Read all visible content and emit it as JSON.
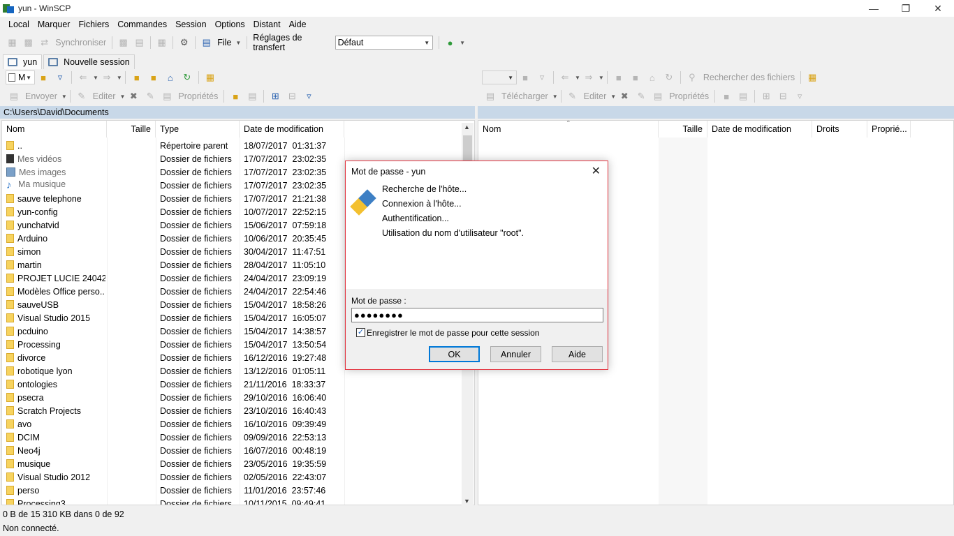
{
  "window": {
    "title": "yun - WinSCP"
  },
  "menu": [
    "Local",
    "Marquer",
    "Fichiers",
    "Commandes",
    "Session",
    "Options",
    "Distant",
    "Aide"
  ],
  "toolbar": {
    "sync_label": "Synchroniser",
    "file_label": "File",
    "transfer_settings_label": "Réglages de transfert",
    "transfer_preset": "Défaut"
  },
  "tabs": [
    {
      "label": "yun"
    },
    {
      "label": "Nouvelle session"
    }
  ],
  "local": {
    "drive_label": "M",
    "upload_label": "Envoyer",
    "edit_label": "Editer",
    "properties_label": "Propriétés",
    "path": "C:\\Users\\David\\Documents",
    "columns": [
      "Nom",
      "Taille",
      "Type",
      "Date de modification"
    ],
    "rows": [
      {
        "name": "..",
        "type": "Répertoire parent",
        "date": "18/07/2017  01:31:37",
        "icon": "up"
      },
      {
        "name": "Mes vidéos",
        "type": "Dossier de fichiers",
        "date": "17/07/2017  23:02:35",
        "icon": "video",
        "dim": true
      },
      {
        "name": "Mes images",
        "type": "Dossier de fichiers",
        "date": "17/07/2017  23:02:35",
        "icon": "image",
        "dim": true
      },
      {
        "name": "Ma musique",
        "type": "Dossier de fichiers",
        "date": "17/07/2017  23:02:35",
        "icon": "music",
        "dim": true
      },
      {
        "name": "sauve telephone",
        "type": "Dossier de fichiers",
        "date": "17/07/2017  21:21:38",
        "icon": "folder"
      },
      {
        "name": "yun-config",
        "type": "Dossier de fichiers",
        "date": "10/07/2017  22:52:15",
        "icon": "folder"
      },
      {
        "name": "yunchatvid",
        "type": "Dossier de fichiers",
        "date": "15/06/2017  07:59:18",
        "icon": "folder"
      },
      {
        "name": "Arduino",
        "type": "Dossier de fichiers",
        "date": "10/06/2017  20:35:45",
        "icon": "folder"
      },
      {
        "name": "simon",
        "type": "Dossier de fichiers",
        "date": "30/04/2017  11:47:51",
        "icon": "folder"
      },
      {
        "name": "martin",
        "type": "Dossier de fichiers",
        "date": "28/04/2017  11:05:10",
        "icon": "folder"
      },
      {
        "name": "PROJET LUCIE 240420...",
        "type": "Dossier de fichiers",
        "date": "24/04/2017  23:09:19",
        "icon": "folder"
      },
      {
        "name": "Modèles Office perso...",
        "type": "Dossier de fichiers",
        "date": "24/04/2017  22:54:46",
        "icon": "folder"
      },
      {
        "name": "sauveUSB",
        "type": "Dossier de fichiers",
        "date": "15/04/2017  18:58:26",
        "icon": "folder"
      },
      {
        "name": "Visual Studio 2015",
        "type": "Dossier de fichiers",
        "date": "15/04/2017  16:05:07",
        "icon": "folder"
      },
      {
        "name": "pcduino",
        "type": "Dossier de fichiers",
        "date": "15/04/2017  14:38:57",
        "icon": "folder"
      },
      {
        "name": "Processing",
        "type": "Dossier de fichiers",
        "date": "15/04/2017  13:50:54",
        "icon": "folder"
      },
      {
        "name": "divorce",
        "type": "Dossier de fichiers",
        "date": "16/12/2016  19:27:48",
        "icon": "folder"
      },
      {
        "name": "robotique lyon",
        "type": "Dossier de fichiers",
        "date": "13/12/2016  01:05:11",
        "icon": "folder"
      },
      {
        "name": "ontologies",
        "type": "Dossier de fichiers",
        "date": "21/11/2016  18:33:37",
        "icon": "folder"
      },
      {
        "name": "psecra",
        "type": "Dossier de fichiers",
        "date": "29/10/2016  16:06:40",
        "icon": "folder"
      },
      {
        "name": "Scratch Projects",
        "type": "Dossier de fichiers",
        "date": "23/10/2016  16:40:43",
        "icon": "folder"
      },
      {
        "name": "avo",
        "type": "Dossier de fichiers",
        "date": "16/10/2016  09:39:49",
        "icon": "folder"
      },
      {
        "name": "DCIM",
        "type": "Dossier de fichiers",
        "date": "09/09/2016  22:53:13",
        "icon": "folder"
      },
      {
        "name": "Neo4j",
        "type": "Dossier de fichiers",
        "date": "16/07/2016  00:48:19",
        "icon": "folder"
      },
      {
        "name": "musique",
        "type": "Dossier de fichiers",
        "date": "23/05/2016  19:35:59",
        "icon": "folder"
      },
      {
        "name": "Visual Studio 2012",
        "type": "Dossier de fichiers",
        "date": "02/05/2016  22:43:07",
        "icon": "folder"
      },
      {
        "name": "perso",
        "type": "Dossier de fichiers",
        "date": "11/01/2016  23:57:46",
        "icon": "folder"
      },
      {
        "name": "Processing3",
        "type": "Dossier de fichiers",
        "date": "10/11/2015  09:49:41",
        "icon": "folder"
      }
    ]
  },
  "remote": {
    "search_label": "Rechercher des fichiers",
    "download_label": "Télécharger",
    "edit_label": "Editer",
    "properties_label": "Propriétés",
    "columns": [
      "Nom",
      "Taille",
      "Date de modification",
      "Droits",
      "Proprié..."
    ]
  },
  "status": {
    "summary": "0 B de 15 310 KB dans 0 de 92",
    "connection": "Non connecté."
  },
  "dialog": {
    "title": "Mot de passe - yun",
    "messages": [
      "Recherche de l'hôte...",
      "Connexion à l'hôte...",
      "Authentification...",
      "Utilisation du nom d'utilisateur \"root\"."
    ],
    "password_label": "Mot de passe :",
    "password_value": "●●●●●●●●",
    "remember_label": "Enregistrer le mot de passe pour cette session",
    "remember_checked": true,
    "ok_label": "OK",
    "cancel_label": "Annuler",
    "help_label": "Aide"
  }
}
